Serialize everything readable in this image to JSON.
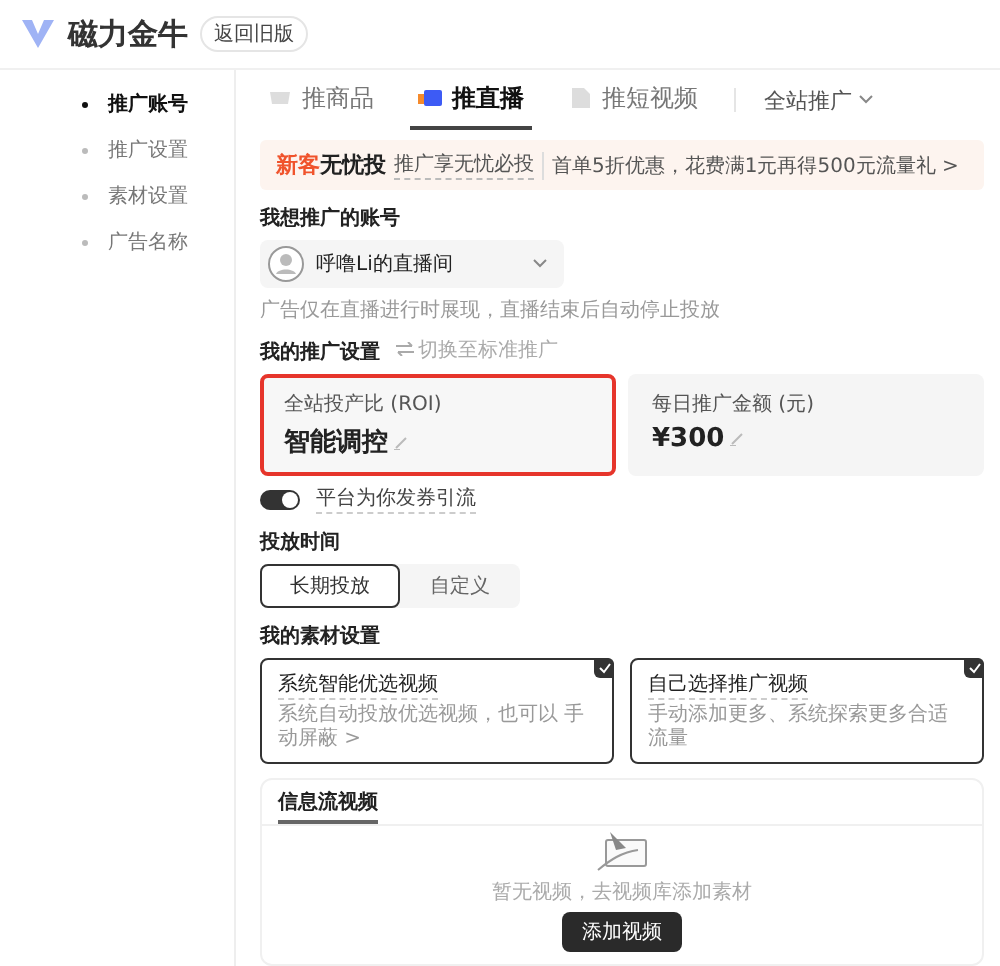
{
  "header": {
    "brand": "磁力金牛",
    "badge": "返回旧版"
  },
  "sidebar": {
    "items": [
      {
        "label": "推广账号",
        "selected": true
      },
      {
        "label": "推广设置",
        "selected": false
      },
      {
        "label": "素材设置",
        "selected": false
      },
      {
        "label": "广告名称",
        "selected": false
      }
    ]
  },
  "tabs": [
    {
      "label": "推商品",
      "selected": false
    },
    {
      "label": "推直播",
      "selected": true
    },
    {
      "label": "推短视频",
      "selected": false
    }
  ],
  "scope_menu": {
    "label": "全站推广"
  },
  "banner": {
    "title_accent": "新客",
    "title": "无忧投",
    "link": "推广享无忧必投",
    "text": "首单5折优惠，花费满1元再得500元流量礼 >"
  },
  "account": {
    "label": "我想推广的账号",
    "value": "呼噜Li的直播间",
    "note": "广告仅在直播进行时展现，直播结束后自动停止投放"
  },
  "settings": {
    "label": "我的推广设置",
    "switch_link": "切换至标准推广",
    "cards": [
      {
        "label": "全站投产比 (ROI)",
        "value": "智能调控",
        "highlighted": true
      },
      {
        "label": "每日推广金额 (元)",
        "value": "¥300",
        "highlighted": false
      }
    ],
    "coupon": {
      "label": "平台为你发券引流",
      "on": true
    }
  },
  "schedule": {
    "label": "投放时间",
    "options": [
      {
        "label": "长期投放",
        "selected": true
      },
      {
        "label": "自定义",
        "selected": false
      }
    ]
  },
  "materials": {
    "label": "我的素材设置",
    "options": [
      {
        "title": "系统智能优选视频",
        "description": "系统自动投放优选视频，也可以 手动屏蔽 >",
        "checked": true
      },
      {
        "title": "自己选择推广视频",
        "description": "手动添加更多、系统探索更多合适流量",
        "checked": true
      }
    ]
  },
  "video_panel": {
    "tabs": [
      {
        "label": "信息流视频",
        "selected": true
      }
    ],
    "empty_text": "暂无视频，去视频库添加素材",
    "button": "添加视频"
  }
}
